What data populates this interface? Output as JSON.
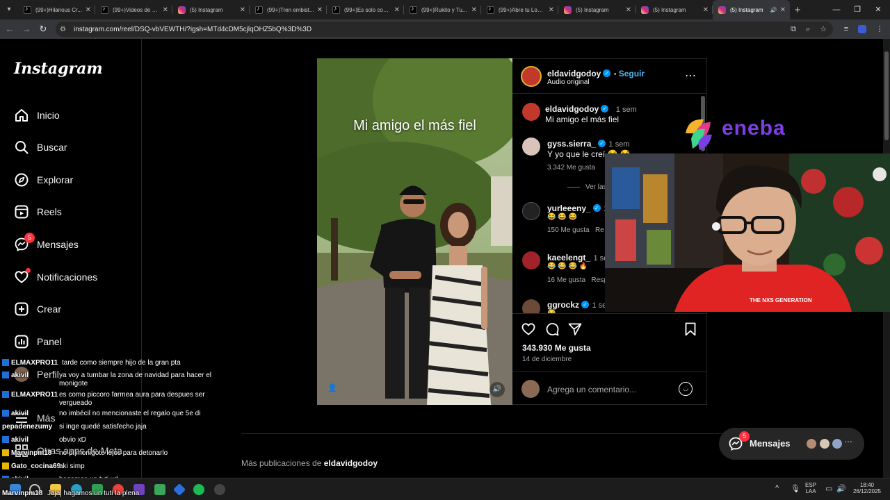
{
  "browser": {
    "tabs": [
      {
        "label": "(99+)Hilarious Cr...",
        "icon": "tiktok-icon"
      },
      {
        "label": "(99+)Videos de M...",
        "icon": "tiktok-icon"
      },
      {
        "label": "(5) Instagram",
        "icon": "instagram-icon"
      },
      {
        "label": "(99+)Tren embist...",
        "icon": "tiktok-icon"
      },
      {
        "label": "(99+)Es solo cont...",
        "icon": "tiktok-icon"
      },
      {
        "label": "(99+)Rukito y Tu...",
        "icon": "tiktok-icon"
      },
      {
        "label": "(99+)Abre tu Loca...",
        "icon": "tiktok-icon"
      },
      {
        "label": "(5) Instagram",
        "icon": "instagram-icon"
      },
      {
        "label": "(5) Instagram",
        "icon": "instagram-icon"
      },
      {
        "label": "(5) Instagram",
        "icon": "instagram-icon",
        "active": true
      }
    ],
    "url": "instagram.com/reel/DSQ-vbVEWTH/?igsh=MTd4cDM5cjlqOHZ5bQ%3D%3D"
  },
  "sidebar": {
    "logo": "Instagram",
    "items": [
      {
        "label": "Inicio",
        "icon": "home-icon"
      },
      {
        "label": "Buscar",
        "icon": "search-icon"
      },
      {
        "label": "Explorar",
        "icon": "compass-icon"
      },
      {
        "label": "Reels",
        "icon": "reels-icon"
      },
      {
        "label": "Mensajes",
        "icon": "messenger-icon",
        "badge": "5"
      },
      {
        "label": "Notificaciones",
        "icon": "heart-icon"
      },
      {
        "label": "Crear",
        "icon": "plus-square-icon"
      },
      {
        "label": "Panel",
        "icon": "chart-icon"
      },
      {
        "label": "Perfil",
        "icon": "avatar"
      },
      {
        "label": "Más",
        "icon": "menu-icon"
      },
      {
        "label": "Otras apps de Meta",
        "icon": "meta-icon"
      }
    ]
  },
  "reel": {
    "caption_overlay": "Mi amigo el más fiel",
    "author": "eldavidgodoy",
    "follow": "Seguir",
    "audio": "Audio original",
    "comments": [
      {
        "user": "eldavidgodoy",
        "verified": true,
        "time": "1 sem",
        "text": "Mi amigo el más fiel"
      },
      {
        "user": "gyss.sierra_",
        "verified": true,
        "time": "1 sem",
        "text": "Y yo que le creí 😂 😂",
        "likes": "3.342 Me gusta",
        "reply": "Responder",
        "replies": "Ver las 19 respuestas"
      },
      {
        "user": "yurleeeny_",
        "verified": true,
        "time": "1",
        "text": "😂 😂 😂",
        "likes": "150 Me gusta",
        "reply": "Re"
      },
      {
        "user": "kaeelengt_",
        "verified": false,
        "time": "1 sem",
        "text": "😂 😂 😂 🔥",
        "likes": "16 Me gusta",
        "reply": "Resp"
      },
      {
        "user": "ggrockz",
        "verified": true,
        "time": "1 se",
        "text": "😂"
      }
    ],
    "likes": "343.930 Me gusta",
    "date": "14 de diciembre",
    "comment_placeholder": "Agrega un comentario..."
  },
  "more_posts": {
    "prefix": "Más publicaciones de",
    "user": "eldavidgodoy"
  },
  "messages_pill": {
    "label": "Mensajes",
    "badge": "5"
  },
  "overlay_brand": "eneba",
  "webcam_shirt_text": "THE NXS GENERATION",
  "chat": [
    {
      "user": "ELMAXPRO11",
      "badge": "blue",
      "msg": "tarde como siempre hijo de la gran pta"
    },
    {
      "user": "akivil",
      "badge": "blue",
      "msg": "ya voy a tumbar la zona de navidad para hacer el",
      "msg2": "monigote"
    },
    {
      "user": "ELMAXPRO11",
      "badge": "blue",
      "msg": "es como piccoro farmea aura para despues ser",
      "msg2": "vergueado"
    },
    {
      "user": "akivil",
      "badge": "blue",
      "msg": "no imbécil no mencionaste el regalo que 5e di"
    },
    {
      "user": "pepadenezumy",
      "badge": "",
      "msg": "si inge quedé satisfecho jaja"
    },
    {
      "user": "akivil",
      "badge": "blue",
      "msg": "obvio xD"
    },
    {
      "user": "Marvinpm18",
      "badge": "yellow",
      "msg": "no di monigote lejos para detonarlo"
    },
    {
      "user": "Gato_cocina69",
      "badge": "yellow",
      "msg": "aki simp"
    },
    {
      "user": "akivil",
      "badge": "blue",
      "msg": "hagamos un tuti xd"
    },
    {
      "user": "Marvinpm18",
      "badge": "blue",
      "msg": "Jajaj hagamos un tuti la plena"
    }
  ],
  "taskbar": {
    "lang": "ESP",
    "lang2": "LAA",
    "time": "18:40",
    "date": "26/12/2025"
  }
}
